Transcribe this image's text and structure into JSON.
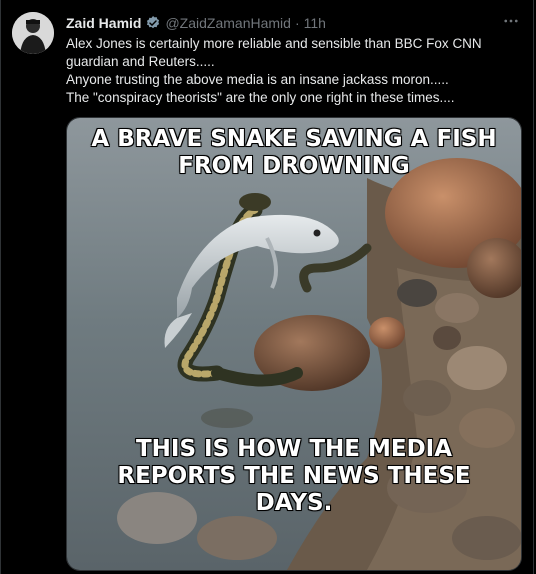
{
  "tweet": {
    "author_name": "Zaid Hamid",
    "handle": "@ZaidZamanHamid",
    "separator": "·",
    "time": "11h",
    "more_icon": "ellipsis-icon",
    "verified_icon": "verified-badge-icon",
    "text_lines": [
      "Alex Jones is certainly more reliable and sensible than BBC Fox CNN",
      "guardian and Reuters.....",
      "Anyone trusting the above media is an insane jackass moron.....",
      "The \"conspiracy theorists\"  are the only one right in these times...."
    ]
  },
  "meme": {
    "top_caption_lines": [
      "A BRAVE SNAKE SAVING A FISH",
      "FROM DROWNING"
    ],
    "bottom_caption_lines": [
      "THIS IS HOW THE MEDIA",
      "REPORTS THE NEWS THESE",
      "DAYS."
    ]
  },
  "colors": {
    "background": "#000000",
    "text_primary": "#e7e9ea",
    "text_secondary": "#71767b",
    "verified": "#829aab"
  }
}
